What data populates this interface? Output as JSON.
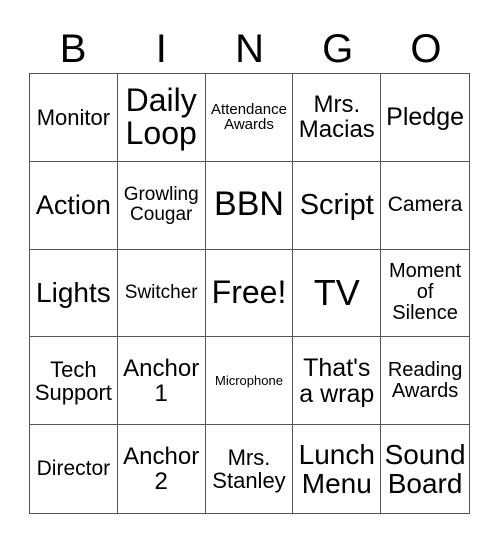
{
  "header": [
    "B",
    "I",
    "N",
    "G",
    "O"
  ],
  "cells": [
    {
      "text": "Monitor",
      "size": 22
    },
    {
      "text": "Daily Loop",
      "size": 32
    },
    {
      "text": "Attendance Awards",
      "size": 15
    },
    {
      "text": "Mrs. Macias",
      "size": 24
    },
    {
      "text": "Pledge",
      "size": 25
    },
    {
      "text": "Action",
      "size": 27
    },
    {
      "text": "Growling Cougar",
      "size": 19
    },
    {
      "text": "BBN",
      "size": 34
    },
    {
      "text": "Script",
      "size": 29
    },
    {
      "text": "Camera",
      "size": 21
    },
    {
      "text": "Lights",
      "size": 28
    },
    {
      "text": "Switcher",
      "size": 19
    },
    {
      "text": "Free!",
      "size": 32
    },
    {
      "text": "TV",
      "size": 36
    },
    {
      "text": "Moment of Silence",
      "size": 20
    },
    {
      "text": "Tech Support",
      "size": 22
    },
    {
      "text": "Anchor 1",
      "size": 24
    },
    {
      "text": "Microphone",
      "size": 13
    },
    {
      "text": "That's a wrap",
      "size": 25
    },
    {
      "text": "Reading Awards",
      "size": 20
    },
    {
      "text": "Director",
      "size": 21
    },
    {
      "text": "Anchor 2",
      "size": 24
    },
    {
      "text": "Mrs. Stanley",
      "size": 22
    },
    {
      "text": "Lunch Menu",
      "size": 28
    },
    {
      "text": "Sound Board",
      "size": 28
    }
  ]
}
